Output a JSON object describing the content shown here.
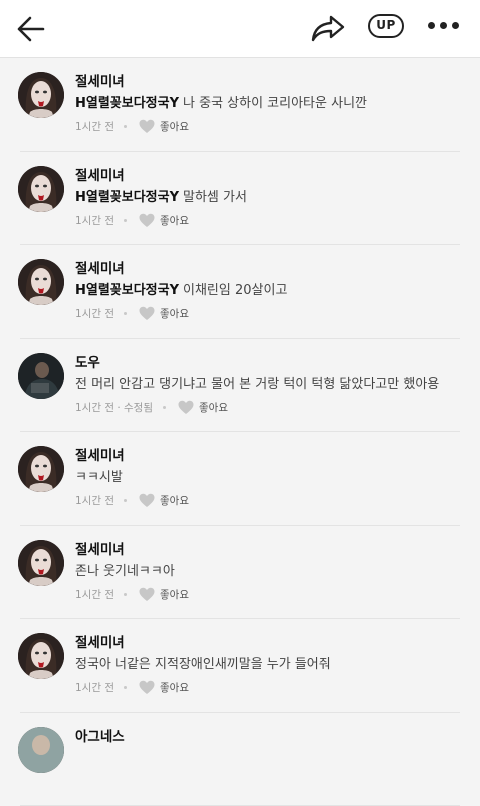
{
  "topbar": {
    "back_icon": "arrow-left-icon",
    "share_icon": "share-arrow-icon",
    "up_label": "UP",
    "more_icon": "more-dots-icon"
  },
  "comments": [
    {
      "author": "절세미녀",
      "mention": "H열렬꽂보다정국Y",
      "text": "나 중국 상하이 코리아타운 사니깐",
      "time": "1시간 전",
      "like_label": "좋아요",
      "avatar": "woman"
    },
    {
      "author": "절세미녀",
      "mention": "H열렬꽂보다정국Y",
      "text": "말하셈 가서",
      "time": "1시간 전",
      "like_label": "좋아요",
      "avatar": "woman"
    },
    {
      "author": "절세미녀",
      "mention": "H열렬꽂보다정국Y",
      "text": "이채린임 20살이고",
      "time": "1시간 전",
      "like_label": "좋아요",
      "avatar": "woman"
    },
    {
      "author": "도우",
      "mention": "",
      "text": "전 머리 안감고 댕기냐고 물어 본 거랑 턱이 턱형 닮았다고만 했아용",
      "time": "1시간 전 · 수정됨",
      "like_label": "좋아요",
      "avatar": "man"
    },
    {
      "author": "절세미녀",
      "mention": "",
      "text": "ㅋㅋ시발",
      "time": "1시간 전",
      "like_label": "좋아요",
      "avatar": "woman"
    },
    {
      "author": "절세미녀",
      "mention": "",
      "text": "존나 웃기네ㅋㅋ아",
      "time": "1시간 전",
      "like_label": "좋아요",
      "avatar": "woman"
    },
    {
      "author": "절세미녀",
      "mention": "",
      "text": "정국아 너같은 지적장애인새끼말을 누가 들어줘",
      "time": "1시간 전",
      "like_label": "좋아요",
      "avatar": "woman"
    },
    {
      "author": "아그네스",
      "mention": "",
      "text": "",
      "time": "",
      "like_label": "",
      "avatar": "other"
    }
  ],
  "colors": {
    "background": "#f4f4f4",
    "topbar": "#ffffff",
    "text": "#222222",
    "muted": "#9a9a9a",
    "heart": "#c7c7c7"
  }
}
